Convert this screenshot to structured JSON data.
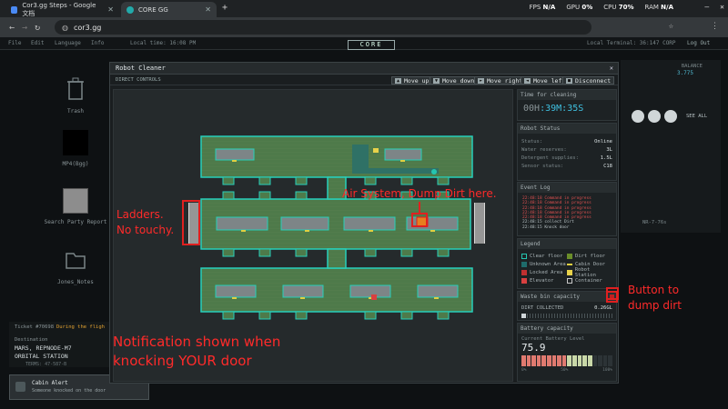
{
  "browser": {
    "tabs": [
      {
        "label": "Cor3.gg Steps - Google 文档"
      },
      {
        "label": "CORE GG"
      }
    ],
    "url": "cor3.gg",
    "perf": {
      "fps_label": "FPS",
      "fps": "N/A",
      "gpu_label": "GPU",
      "gpu": "0%",
      "cpu_label": "CPU",
      "cpu": "70%",
      "ram_label": "RAM",
      "ram": "N/A"
    }
  },
  "app": {
    "menu": [
      "File",
      "Edit",
      "Language",
      "Info"
    ],
    "local_time": "Local time: 16:08 PM",
    "logo": "CORE",
    "terminal": "Local Terminal: 36:147 CORP",
    "logout": "Log Out"
  },
  "desktop": [
    {
      "label": "Trash"
    },
    {
      "label": "MP4(Bgg)"
    },
    {
      "label": "Search Party Report"
    },
    {
      "label": "Jones_Notes"
    }
  ],
  "dialog": {
    "title": "Robot Cleaner",
    "direct_controls": "DIRECT CONTROLS",
    "controls": [
      {
        "key": "▲",
        "label": "Move up"
      },
      {
        "key": "▼",
        "label": "Move down"
      },
      {
        "key": "►",
        "label": "Move right"
      },
      {
        "key": "◄",
        "label": "Move left"
      },
      {
        "key": "■",
        "label": "Disconnect"
      }
    ],
    "time": {
      "header": "Time for cleaning",
      "h": "00H",
      "m": "39M",
      "s": "35S"
    },
    "status": {
      "header": "Robot Status",
      "rows": [
        {
          "k": "Status:",
          "v": "Online"
        },
        {
          "k": "Water reserves:",
          "v": "3L"
        },
        {
          "k": "Detergent supplies:",
          "v": "1.5L"
        },
        {
          "k": "Sensor status:",
          "v": "C18"
        }
      ]
    },
    "log": {
      "header": "Event Log",
      "lines": [
        "22:48:18 Command in progress",
        "22:48:18 Command in progress",
        "22:48:18 Command in progress",
        "22:48:18 Command in progress",
        "22:48:18 Command in progress",
        "22:48:15 collect Dirt",
        "22:48:15 Knock door"
      ]
    },
    "legend": {
      "header": "Legend",
      "items": [
        {
          "label": "Clear floor",
          "color": "#25c5b0"
        },
        {
          "label": "Dirt floor",
          "color": "#6b8e2a"
        },
        {
          "label": "Unknown Area",
          "color": "#1e6b6b"
        },
        {
          "label": "Cabin Door",
          "color": "#e0d040"
        },
        {
          "label": "Locked Area",
          "color": "#c03030"
        },
        {
          "label": "Robot Station",
          "color": "#e8d24a"
        },
        {
          "label": "Elevator",
          "color": "#d84040"
        },
        {
          "label": "Container",
          "color": "#c8c8c8"
        }
      ]
    },
    "waste": {
      "header": "Waste bin capacity",
      "label": "DIRT COLLECTED",
      "value": "0.26GL",
      "fraction": 0.05
    },
    "battery": {
      "header": "Battery capacity",
      "label": "Current Battery Level",
      "value": "75.9",
      "ticks": [
        "0%",
        "50%",
        "100%"
      ]
    }
  },
  "right_panel": {
    "balance_label": "BALANCE",
    "balance": "3.775",
    "see_all": "SEE ALL",
    "code": "NR-7-76s"
  },
  "ticker": {
    "ticket": "Ticket #70698",
    "flight": "During the fligh",
    "destination_label": "Destination",
    "destination": "MARS, REPNODE-M7",
    "station": "ORBITAL STATION",
    "small": "TERMS: 47-587-B"
  },
  "notification": {
    "title": "Cabin Alert",
    "body": "Someone knocked on the door"
  },
  "annotations": {
    "ladders": "Ladders.\nNo touchy.",
    "air": "Air System, Dump Dirt here.",
    "button": "Button to\ndump dirt",
    "notif": "Notification shown when\nknocking YOUR door"
  }
}
